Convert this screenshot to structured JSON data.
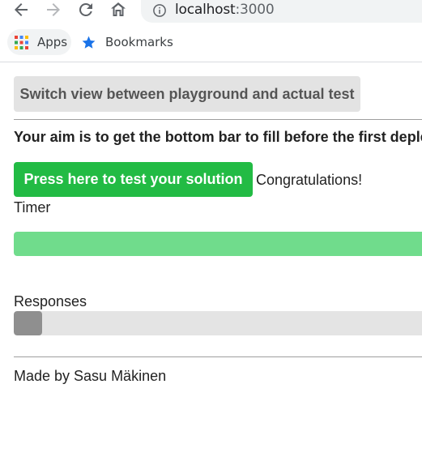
{
  "browser": {
    "url_host": "localhost",
    "url_port": ":3000",
    "bookmarks": {
      "apps_label": "Apps",
      "bookmarks_label": "Bookmarks"
    },
    "icons": {
      "back": "back-arrow-icon",
      "forward": "forward-arrow-icon",
      "reload": "reload-icon",
      "home": "home-icon",
      "site_info": "info-icon",
      "apps": "apps-grid-icon",
      "bookmark": "star-icon"
    }
  },
  "page": {
    "switch_button_label": "Switch view between playground and actual test",
    "aim_text": "Your aim is to get the bottom bar to fill before the first deplet",
    "test_button_label": "Press here to test your solution",
    "status_text": "Congratulations!",
    "timer_label": "Timer",
    "timer_progress": 1.0,
    "responses_label": "Responses",
    "responses_progress": 0.07,
    "footer_text": "Made by Sasu Mäkinen"
  },
  "colors": {
    "test_button": "#22bb44",
    "timer_fill": "#70dc8c",
    "responses_fill": "#8f8f8f",
    "track": "#e4e4e4",
    "switch_button": "#e3e3e3"
  }
}
